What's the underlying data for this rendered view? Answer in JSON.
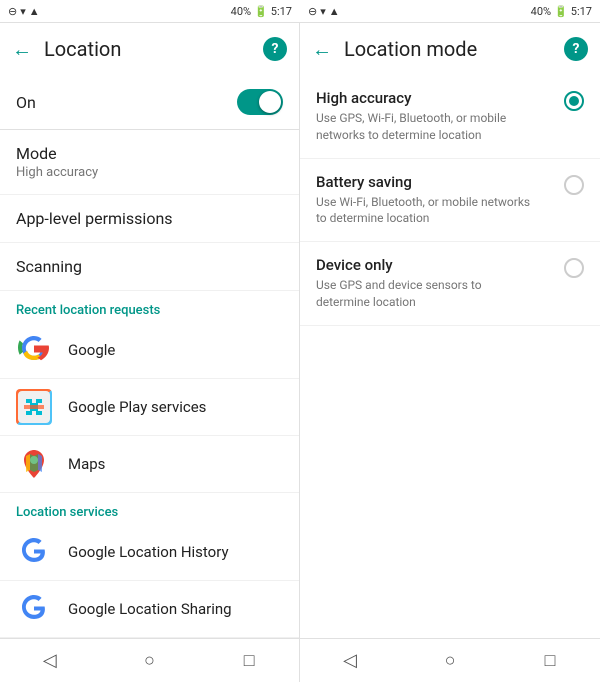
{
  "status": {
    "left": {
      "battery": "40%",
      "time": "5:17"
    },
    "right": {
      "battery": "40%",
      "time": "5:17"
    }
  },
  "left_panel": {
    "title": "Location",
    "toggle": {
      "label": "On",
      "state": true
    },
    "items": [
      {
        "label": "Mode",
        "sublabel": "High accuracy"
      },
      {
        "label": "App-level permissions",
        "sublabel": ""
      },
      {
        "label": "Scanning",
        "sublabel": ""
      }
    ],
    "recent_section": "Recent location requests",
    "recent_apps": [
      {
        "name": "Google",
        "icon": "G"
      },
      {
        "name": "Google Play services",
        "icon": "P"
      },
      {
        "name": "Maps",
        "icon": "M"
      }
    ],
    "services_section": "Location services",
    "service_apps": [
      {
        "name": "Google Location History",
        "icon": "G"
      },
      {
        "name": "Google Location Sharing",
        "icon": "G"
      }
    ]
  },
  "right_panel": {
    "title": "Location mode",
    "options": [
      {
        "label": "High accuracy",
        "sublabel": "Use GPS, Wi-Fi, Bluetooth, or mobile networks to determine location",
        "selected": true
      },
      {
        "label": "Battery saving",
        "sublabel": "Use Wi-Fi, Bluetooth, or mobile networks to determine location",
        "selected": false
      },
      {
        "label": "Device only",
        "sublabel": "Use GPS and device sensors to determine location",
        "selected": false
      }
    ]
  },
  "nav": {
    "back": "◁",
    "home": "○",
    "recent": "□"
  }
}
